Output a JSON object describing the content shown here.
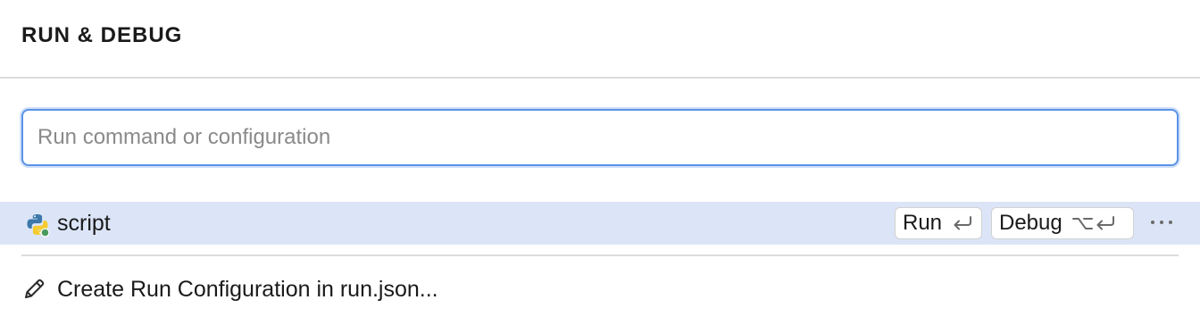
{
  "header": {
    "title": "RUN & DEBUG"
  },
  "search": {
    "placeholder": "Run command or configuration",
    "value": ""
  },
  "configurations": [
    {
      "label": "script",
      "icon": "python-icon",
      "run_label": "Run",
      "run_shortcut": "return-key-icon",
      "debug_label": "Debug",
      "debug_shortcut": "option-return-key-icon",
      "more_icon": "more-horizontal-icon"
    }
  ],
  "create": {
    "label": "Create Run Configuration in run.json...",
    "icon": "pencil-icon"
  },
  "colors": {
    "selection": "#dbe5f7",
    "focus_border": "#5b93e6"
  }
}
